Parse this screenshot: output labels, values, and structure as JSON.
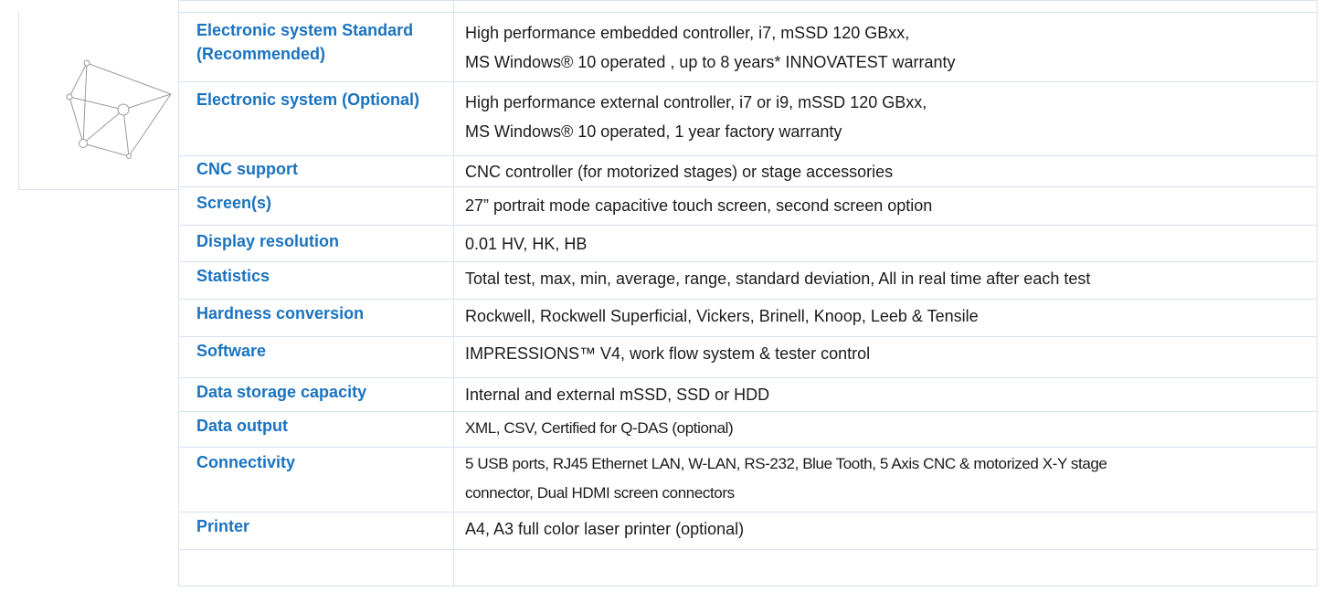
{
  "thumbnail": {
    "icon": "wireframe-geometry-icon",
    "stroke_color": "#9a9a9a"
  },
  "colors": {
    "label": "#1a73c0",
    "border": "#d6e2f0",
    "text": "#1b1b1b"
  },
  "specs": [
    {
      "label": "Electronic system Standard (Recommended)",
      "lines": [
        "High performance embedded controller, i7, mSSD 120 GBxx,",
        "MS Windows® 10 operated , up to 8 years* INNOVATEST warranty"
      ]
    },
    {
      "label": "Electronic system (Optional)",
      "lines": [
        "High performance external controller, i7 or i9, mSSD 120 GBxx,",
        "MS Windows® 10 operated, 1 year factory warranty"
      ]
    },
    {
      "label": "CNC support",
      "lines": [
        "CNC controller (for motorized stages) or stage accessories"
      ]
    },
    {
      "label": "Screen(s)",
      "lines": [
        "27” portrait mode capacitive touch screen, second screen option"
      ]
    },
    {
      "label": "Display resolution",
      "lines": [
        "0.01 HV, HK, HB"
      ]
    },
    {
      "label": "Statistics",
      "lines": [
        "Total test, max, min, average, range, standard deviation, All in real time after each test"
      ]
    },
    {
      "label": "Hardness conversion",
      "lines": [
        "Rockwell, Rockwell Superficial, Vickers, Brinell, Knoop, Leeb & Tensile"
      ]
    },
    {
      "label": "Software",
      "lines": [
        "IMPRESSIONS™ V4, work flow system & tester control"
      ]
    },
    {
      "label": "Data storage capacity",
      "lines": [
        "Internal and external mSSD, SSD or HDD"
      ]
    },
    {
      "label": "Data output",
      "lines": [
        "XML, CSV, Certified for Q-DAS (optional)"
      ]
    },
    {
      "label": "Connectivity",
      "lines": [
        "5 USB ports, RJ45 Ethernet LAN, W-LAN, RS-232, Blue Tooth, 5 Axis CNC & motorized X-Y stage",
        "connector, Dual HDMI screen connectors"
      ]
    },
    {
      "label": "Printer",
      "lines": [
        "A4, A3 full color laser printer (optional)"
      ]
    }
  ]
}
